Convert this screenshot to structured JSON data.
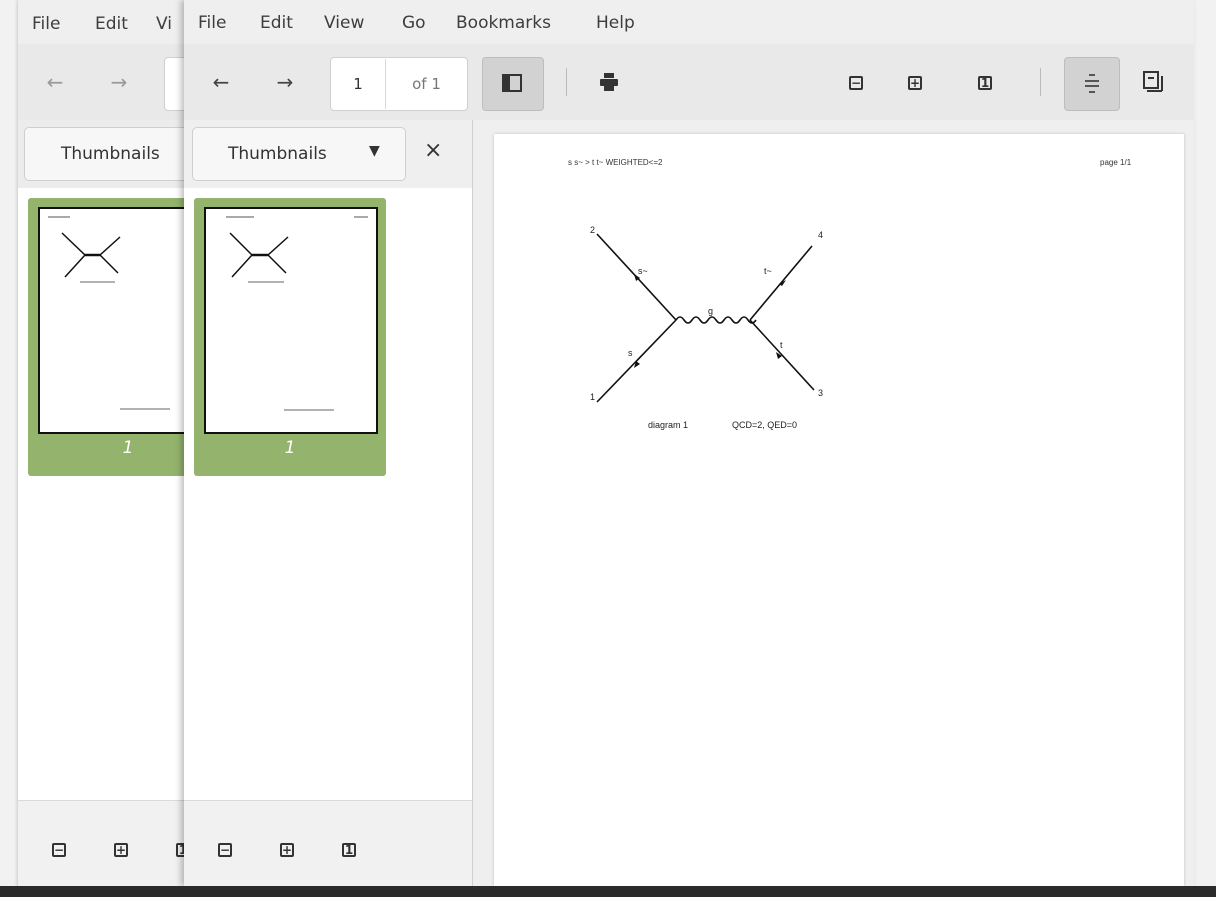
{
  "back_window": {
    "menu": [
      "File",
      "Edit",
      "Vi"
    ],
    "sidebar_mode": "Thumbnails",
    "thumbnail_page": "1"
  },
  "front_window": {
    "menu": [
      "File",
      "Edit",
      "View",
      "Go",
      "Bookmarks",
      "Help"
    ],
    "toolbar": {
      "page_value": "1",
      "page_of": "of 1"
    },
    "sidebar": {
      "mode": "Thumbnails",
      "thumbnail_page": "1"
    },
    "document": {
      "header_left": "s s~ > t t~ WEIGHTED<=2",
      "header_right": "page 1/1",
      "diagram": {
        "labels": {
          "n1": "1",
          "n2": "2",
          "n3": "3",
          "n4": "4",
          "e_s": "s",
          "e_sbar": "s~",
          "e_g": "g",
          "e_t": "t",
          "e_tbar": "t~"
        },
        "caption": "diagram 1",
        "orders": "QCD=2, QED=0"
      }
    }
  },
  "colors": {
    "thumb_selected": "#94b46e"
  }
}
